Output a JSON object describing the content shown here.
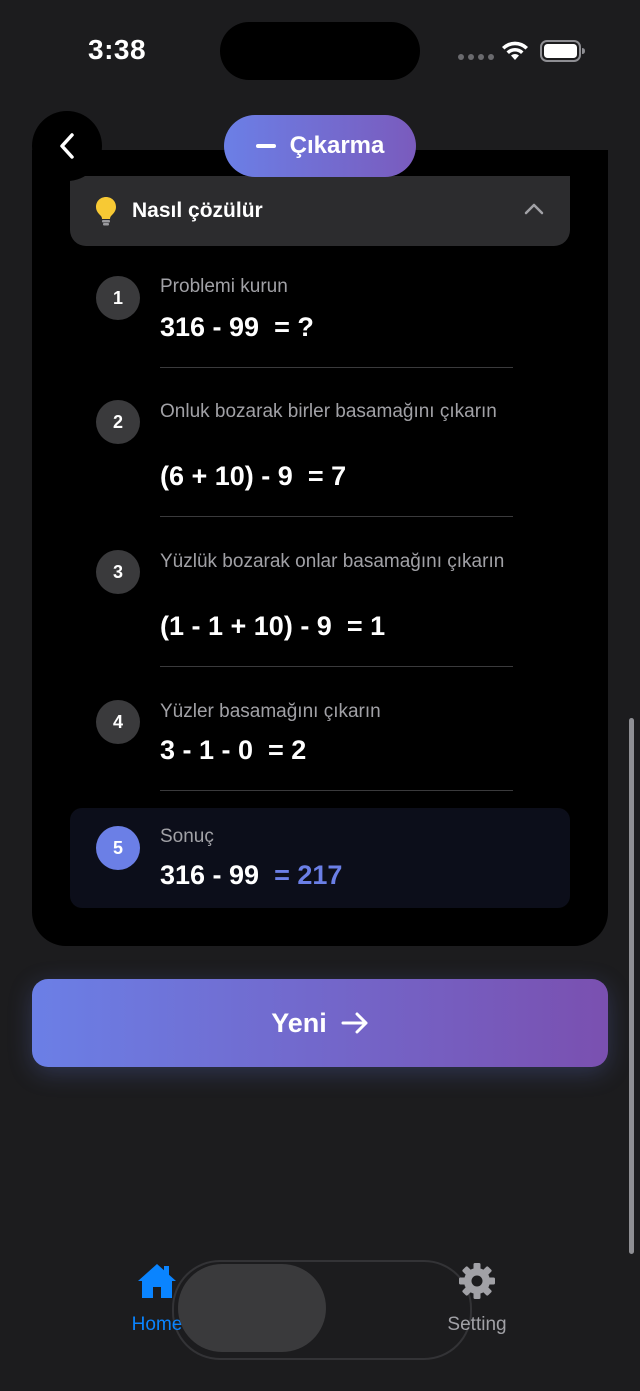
{
  "status_bar": {
    "time": "3:38"
  },
  "header": {
    "title": "Çıkarma"
  },
  "howto": {
    "title": "Nasıl çözülür"
  },
  "steps": [
    {
      "number": "1",
      "description": "Problemi kurun",
      "equation": "316 - 99  = ?"
    },
    {
      "number": "2",
      "description": "Onluk bozarak birler basamağını çıkarın",
      "equation": "(6 + 10) - 9  = 7"
    },
    {
      "number": "3",
      "description": "Yüzlük bozarak onlar basamağını çıkarın",
      "equation": "(1 - 1 + 10) - 9  = 1"
    },
    {
      "number": "4",
      "description": "Yüzler basamağını çıkarın",
      "equation": "3 - 1 - 0  = 2"
    }
  ],
  "result": {
    "number": "5",
    "description": "Sonuç",
    "expression": "316 - 99",
    "value": "= 217"
  },
  "actions": {
    "new_label": "Yeni"
  },
  "tabbar": {
    "home_label": "Home",
    "setting_label": "Setting"
  },
  "colors": {
    "accent": "#6b7fe6",
    "accent_end": "#7a50b0",
    "tab_active": "#0a84ff"
  }
}
